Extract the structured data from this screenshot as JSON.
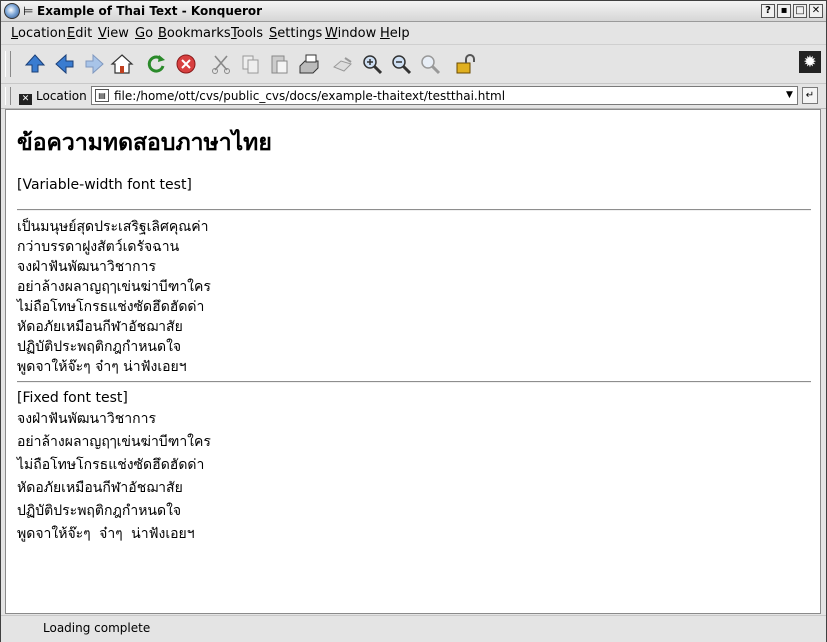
{
  "window": {
    "title": "Example of Thai Text - Konqueror",
    "buttons": [
      "?",
      "▪",
      "□",
      "✕"
    ]
  },
  "menubar": [
    "Location",
    "Edit",
    "View",
    "Go",
    "Bookmarks",
    "Tools",
    "Settings",
    "Window",
    "Help"
  ],
  "toolbar": {
    "icons": [
      "up-arrow-icon",
      "back-arrow-icon",
      "forward-arrow-icon",
      "home-icon",
      "reload-icon",
      "stop-icon",
      "cut-icon",
      "copy-icon",
      "paste-icon",
      "print-icon",
      "security-icon",
      "zoom-in-icon",
      "zoom-out-icon",
      "find-icon",
      "lock-icon",
      "gear-icon"
    ]
  },
  "location": {
    "label": "Location",
    "url": "file:/home/ott/cvs/public_cvs/docs/example-thaitext/testthai.html"
  },
  "page": {
    "heading": "ข้อความทดสอบภาษาไทย",
    "variable_label": "[Variable-width font test]",
    "variable_lines": [
      "เป็นมนุษย์สุดประเสริฐเลิศคุณค่า",
      "กว่าบรรดาฝูงสัตว์เดรัจฉาน",
      "จงฝ่าฟันพัฒนาวิชาการ",
      "อย่าล้างผลาญฤๅเข่นฆ่าบีฑาใคร",
      "ไม่ถือโทษโกรธแช่งซัดฮึดฮัดด่า",
      "หัดอภัยเหมือนกีฬาอัชฌาสัย",
      "ปฏิบัติประพฤติกฎกำหนดใจ",
      "พูดจาให้จ๊ะๆ จ๋าๆ น่าฟังเอยฯ"
    ],
    "fixed_label": "[Fixed font test]",
    "fixed_lines": [
      "จงฝ่าฟันพัฒนาวิชาการ",
      "อย่าล้างผลาญฤๅเข่นฆ่าบีฑาใคร",
      "ไม่ถือโทษโกรธแช่งซัดฮึดฮัดด่า",
      "หัดอภัยเหมือนกีฬาอัชฌาสัย",
      "ปฏิบัติประพฤติกฎกำหนดใจ",
      "พูดจาให้จ๊ะๆ จ๋าๆ น่าฟังเอยฯ"
    ]
  },
  "status": {
    "text": "Loading complete"
  }
}
